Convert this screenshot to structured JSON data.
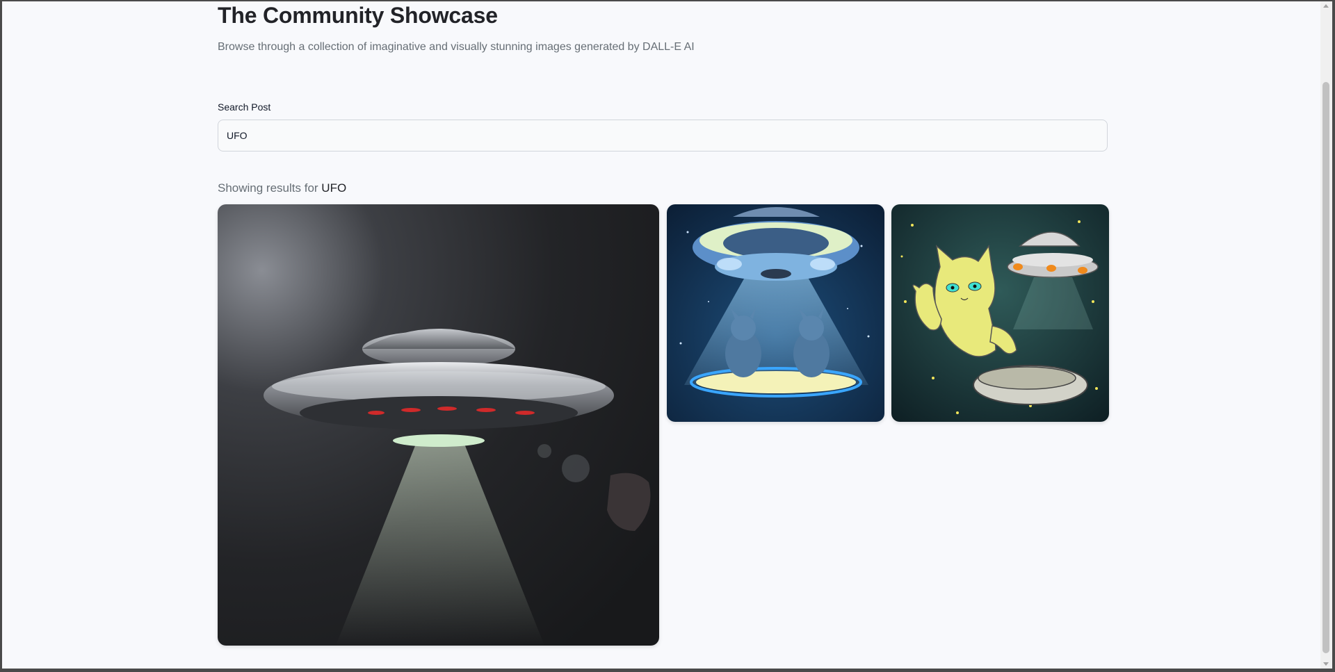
{
  "header": {
    "title": "The Community Showcase",
    "subtitle": "Browse through a collection of imaginative and visually stunning images generated by DALL-E AI"
  },
  "search": {
    "label": "Search Post",
    "value": "UFO"
  },
  "results": {
    "prefix": "Showing results for ",
    "query": "UFO"
  },
  "posts": [
    {
      "icon": "ufo-dark-space-image"
    },
    {
      "icon": "ufo-beaming-aliens-image"
    },
    {
      "icon": "cat-with-ufo-cartoon-image"
    }
  ]
}
